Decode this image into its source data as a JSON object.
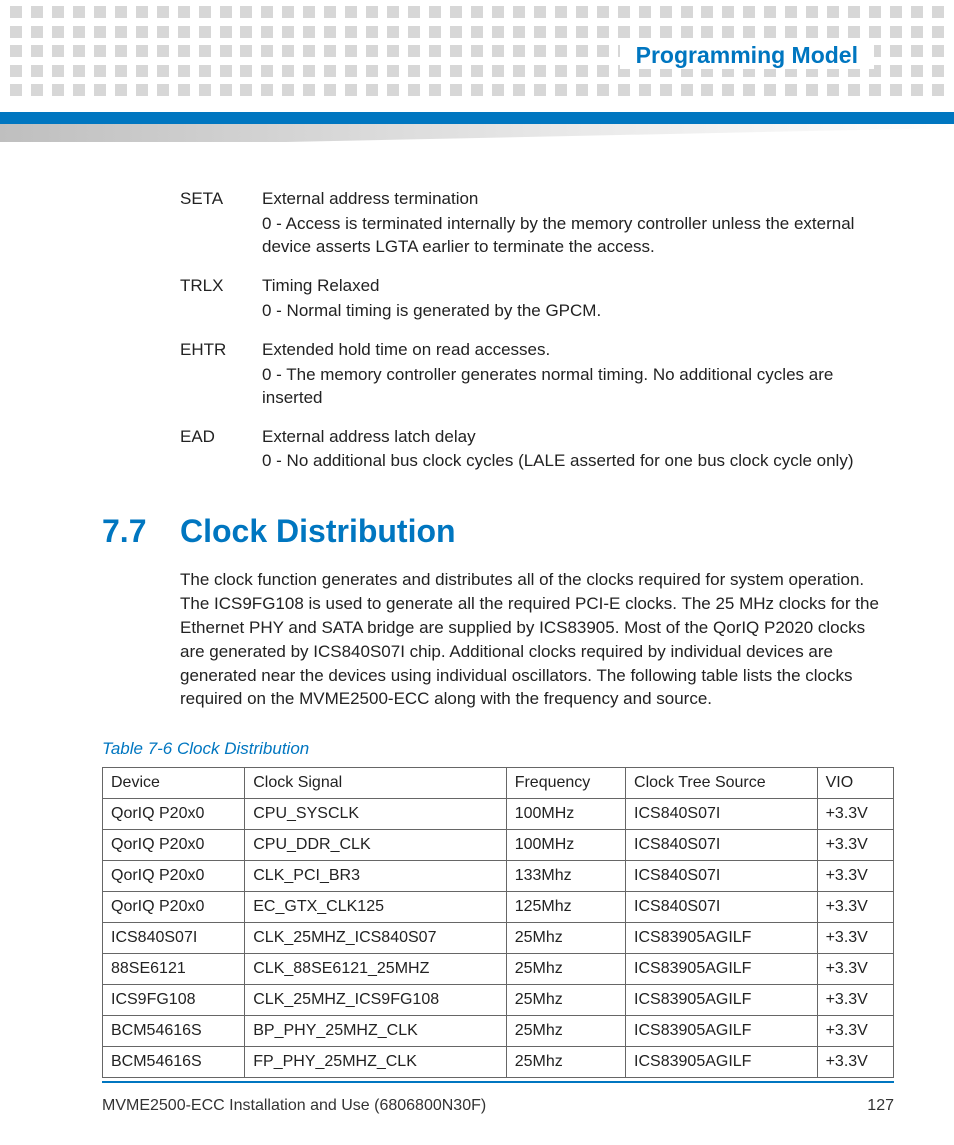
{
  "header": {
    "chapter_title": "Programming Model"
  },
  "params": [
    {
      "name": "SETA",
      "lines": [
        "External address termination",
        "0 - Access is terminated internally by the memory controller unless the external device asserts LGTA earlier to terminate the access."
      ]
    },
    {
      "name": "TRLX",
      "lines": [
        "Timing Relaxed",
        "0 - Normal timing is generated by the GPCM."
      ]
    },
    {
      "name": "EHTR",
      "lines": [
        "Extended hold time on read accesses.",
        "0 - The memory controller generates normal timing. No additional cycles are inserted"
      ]
    },
    {
      "name": "EAD",
      "lines": [
        "External address latch delay",
        "0 - No additional bus clock cycles (LALE asserted for one bus clock cycle only)"
      ]
    }
  ],
  "section": {
    "number": "7.7",
    "title": "Clock Distribution",
    "body": "The clock function generates and distributes all of the clocks required for system operation. The ICS9FG108 is used to generate all the required PCI-E clocks. The 25 MHz clocks for the Ethernet PHY and SATA bridge are supplied by ICS83905. Most of the QorIQ P2020 clocks are generated by ICS840S07I chip. Additional clocks required by individual devices are generated near the devices using individual oscillators. The following table lists the clocks required on the MVME2500-ECC along with the frequency and source."
  },
  "table": {
    "caption": "Table 7-6 Clock Distribution",
    "headers": [
      "Device",
      "Clock Signal",
      "Frequency",
      "Clock Tree Source",
      "VIO"
    ],
    "rows": [
      [
        "QorIQ P20x0",
        "CPU_SYSCLK",
        "100MHz",
        "ICS840S07I",
        "+3.3V"
      ],
      [
        "QorIQ P20x0",
        "CPU_DDR_CLK",
        "100MHz",
        "ICS840S07I",
        "+3.3V"
      ],
      [
        "QorIQ P20x0",
        "CLK_PCI_BR3",
        "133Mhz",
        "ICS840S07I",
        "+3.3V"
      ],
      [
        "QorIQ P20x0",
        "EC_GTX_CLK125",
        "125Mhz",
        "ICS840S07I",
        "+3.3V"
      ],
      [
        "ICS840S07I",
        "CLK_25MHZ_ICS840S07",
        "25Mhz",
        "ICS83905AGILF",
        "+3.3V"
      ],
      [
        "88SE6121",
        "CLK_88SE6121_25MHZ",
        "25Mhz",
        "ICS83905AGILF",
        "+3.3V"
      ],
      [
        "ICS9FG108",
        "CLK_25MHZ_ICS9FG108",
        "25Mhz",
        "ICS83905AGILF",
        "+3.3V"
      ],
      [
        "BCM54616S",
        "BP_PHY_25MHZ_CLK",
        "25Mhz",
        "ICS83905AGILF",
        "+3.3V"
      ],
      [
        "BCM54616S",
        "FP_PHY_25MHZ_CLK",
        "25Mhz",
        "ICS83905AGILF",
        "+3.3V"
      ]
    ]
  },
  "footer": {
    "doc": "MVME2500-ECC Installation and Use (6806800N30F)",
    "page": "127"
  }
}
